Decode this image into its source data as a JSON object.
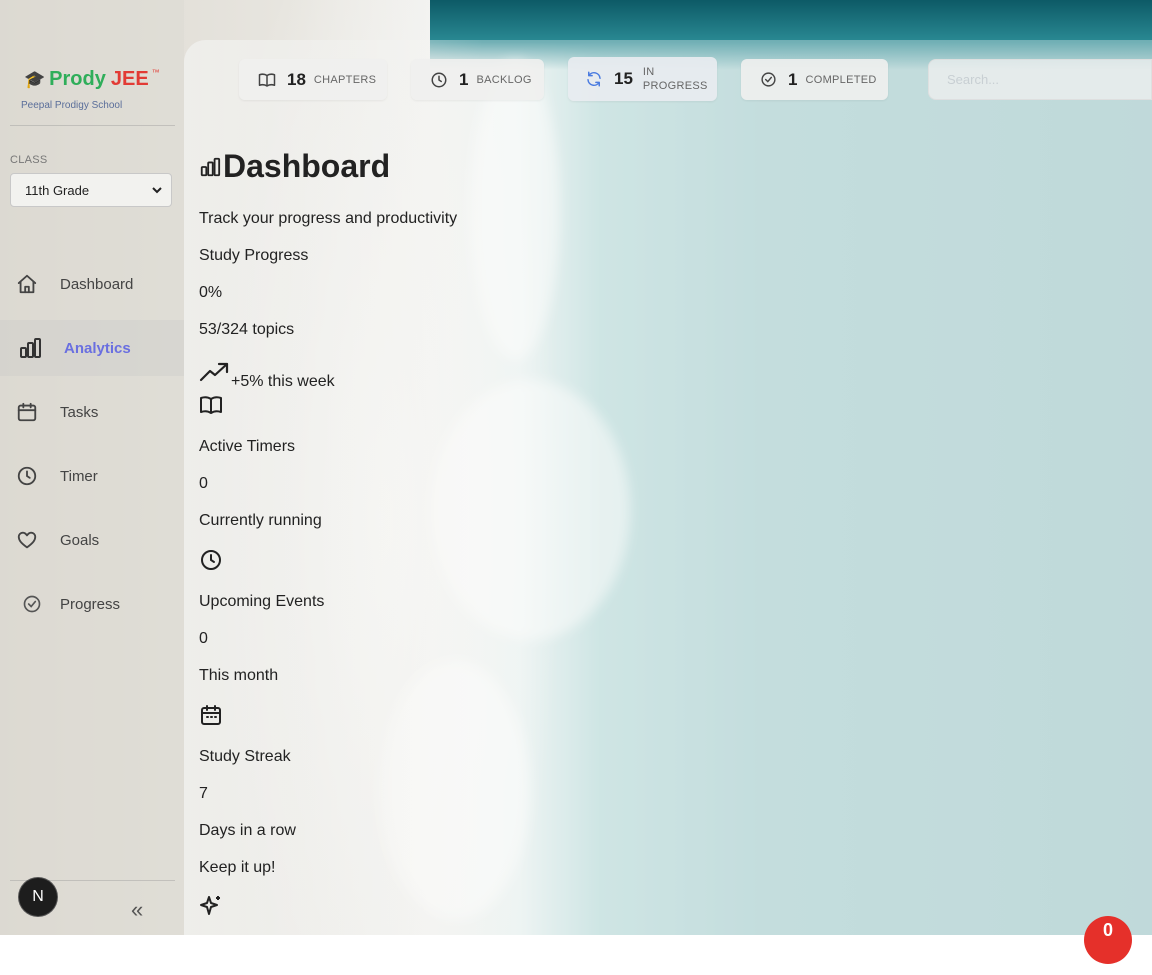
{
  "brand": {
    "name_part1": "Prody",
    "name_part2": "JEE",
    "tm": "™",
    "school": "Peepal Prodigy School"
  },
  "sidebar": {
    "class_label": "CLASS",
    "class_value": "11th Grade",
    "items": [
      {
        "label": "Dashboard",
        "icon": "home-icon"
      },
      {
        "label": "Analytics",
        "icon": "bar-chart-icon",
        "active": true
      },
      {
        "label": "Tasks",
        "icon": "calendar-icon"
      },
      {
        "label": "Timer",
        "icon": "clock-icon"
      },
      {
        "label": "Goals",
        "icon": "heart-icon"
      },
      {
        "label": "Progress",
        "icon": "check-circle-icon"
      }
    ],
    "avatar_initial": "N",
    "collapse_glyph": "«"
  },
  "stats": [
    {
      "value": "18",
      "label": "CHAPTERS",
      "icon": "book-icon"
    },
    {
      "value": "1",
      "label": "BACKLOG",
      "icon": "clock-icon"
    },
    {
      "value": "15",
      "label_line1": "IN",
      "label_line2": "PROGRESS",
      "icon": "refresh-icon",
      "accent": "#4a7be0"
    },
    {
      "value": "1",
      "label": "COMPLETED",
      "icon": "check-circle-icon"
    }
  ],
  "search": {
    "placeholder": "Search..."
  },
  "dashboard": {
    "title": "Dashboard",
    "subtitle": "Track your progress and productivity",
    "study_progress": {
      "label": "Study Progress",
      "percent": "0%",
      "topics": "53/324 topics",
      "trend": "+5% this week"
    },
    "active_timers": {
      "label": "Active Timers",
      "value": "0",
      "sub": "Currently running"
    },
    "upcoming_events": {
      "label": "Upcoming Events",
      "value": "0",
      "sub": "This month"
    },
    "study_streak": {
      "label": "Study Streak",
      "value": "7",
      "sub": "Days in a row",
      "note": "Keep it up!"
    }
  },
  "fab": {
    "label": "0",
    "color": "#e5302a"
  },
  "colors": {
    "accent": "#6a6fe0",
    "brand_green": "#2fae5a",
    "brand_red": "#e23b35"
  }
}
